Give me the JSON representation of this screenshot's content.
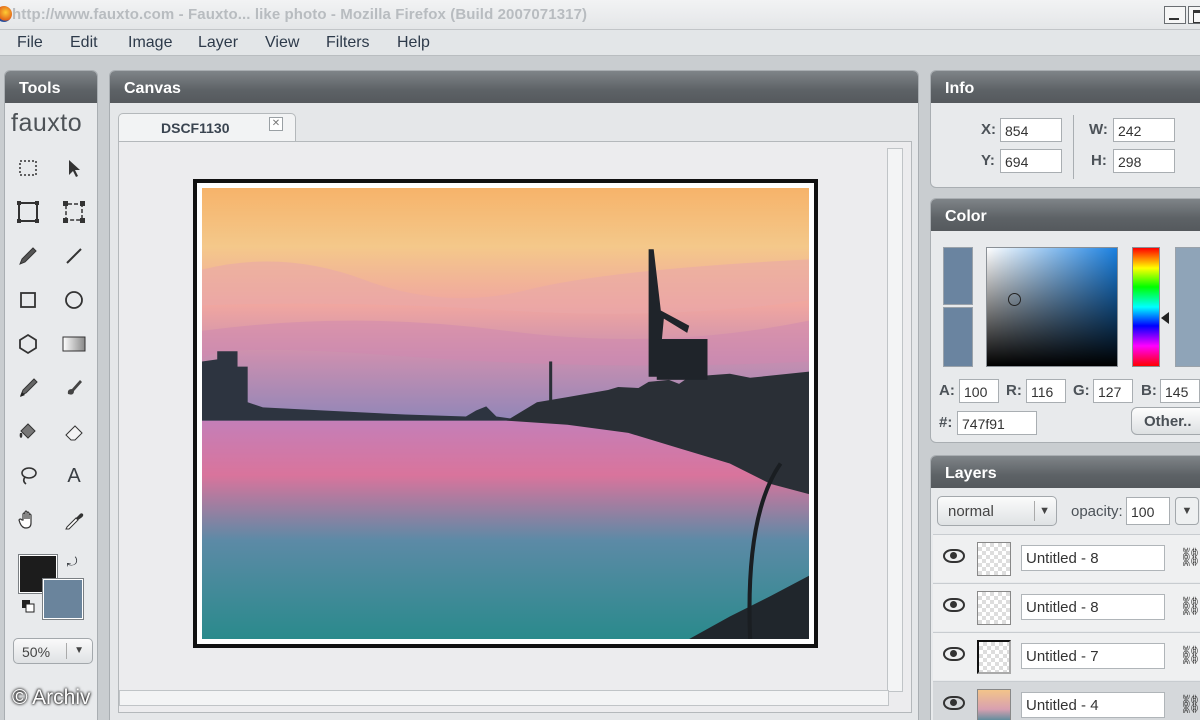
{
  "window": {
    "title": "http://www.fauxto.com - Fauxto... like photo - Mozilla Firefox (Build 2007071317)"
  },
  "menu": [
    "File",
    "Edit",
    "Image",
    "Layer",
    "View",
    "Filters",
    "Help"
  ],
  "tools": {
    "title": "Tools",
    "logo": "fauxto",
    "icons": [
      "marquee-select-icon",
      "pointer-icon",
      "crop-icon",
      "transform-icon",
      "pencil-icon",
      "line-icon",
      "rectangle-icon",
      "ellipse-icon",
      "polygon-icon",
      "gradient-icon",
      "brush-icon",
      "smudge-icon",
      "fill-bucket-icon",
      "eraser-icon",
      "lasso-icon",
      "text-icon",
      "hand-icon",
      "eyedropper-icon"
    ],
    "foreground_color": "#1c1c1c",
    "background_color": "#6a849c",
    "zoom": "50%"
  },
  "canvas": {
    "title": "Canvas",
    "tab_name": "DSCF1130",
    "tab_close": "⊠"
  },
  "info": {
    "title": "Info",
    "x_label": "X:",
    "x": "854",
    "y_label": "Y:",
    "y": "694",
    "w_label": "W:",
    "w": "242",
    "h_label": "H:",
    "h": "298"
  },
  "color": {
    "title": "Color",
    "a_label": "A:",
    "a": "100",
    "r_label": "R:",
    "r": "116",
    "g_label": "G:",
    "g": "127",
    "b_label": "B:",
    "b": "145",
    "hex_label": "#:",
    "hex": "747f91",
    "other_button": "Other.."
  },
  "layers": {
    "title": "Layers",
    "blend_mode": "normal",
    "opacity_label": "opacity:",
    "opacity": "100",
    "items": [
      {
        "name": "Untitled - 8"
      },
      {
        "name": "Untitled - 8"
      },
      {
        "name": "Untitled - 7"
      },
      {
        "name": "Untitled - 4"
      }
    ]
  },
  "watermark": "© Archiv"
}
